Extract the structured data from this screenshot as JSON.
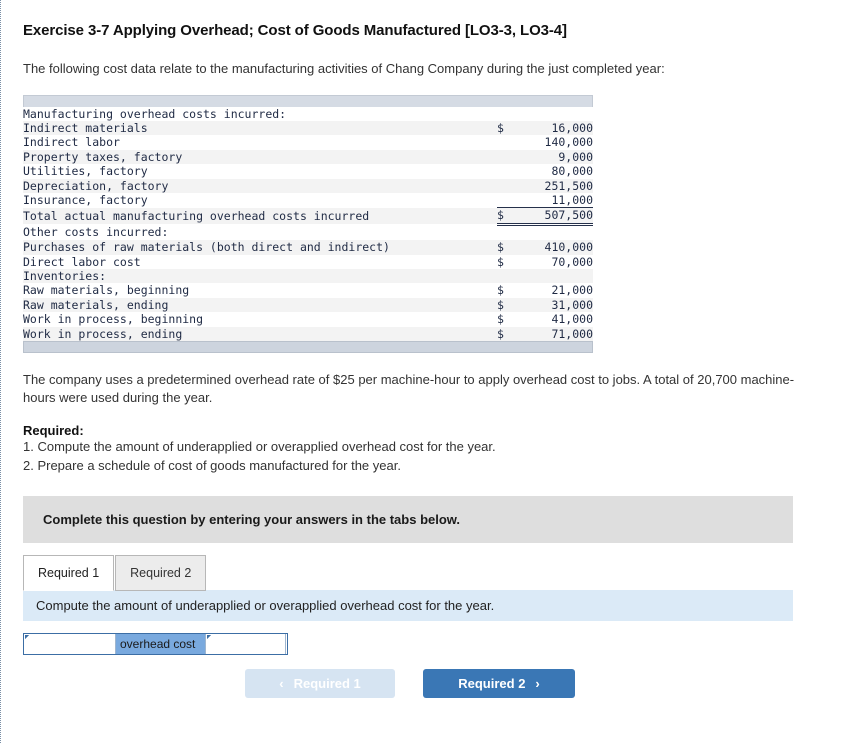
{
  "exercise": {
    "title": "Exercise 3-7 Applying Overhead; Cost of Goods Manufactured [LO3-3, LO3-4]",
    "intro": "The following cost data relate to the manufacturing activities of Chang Company during the just completed year:",
    "mid_paragraph": "The company uses a predetermined overhead rate of $25 per machine-hour to apply overhead cost to jobs. A total of 20,700 machine-hours were used during the year.",
    "required_heading": "Required:",
    "required_items": [
      "1. Compute the amount of underapplied or overapplied overhead cost for the year.",
      "2. Prepare a schedule of cost of goods manufactured for the year."
    ]
  },
  "cost_table": {
    "rows": [
      {
        "label": "Manufacturing overhead costs incurred:",
        "indent": 0,
        "currency": "",
        "amount": "",
        "total": false
      },
      {
        "label": "Indirect materials",
        "indent": 1,
        "currency": "$",
        "amount": "16,000",
        "total": false
      },
      {
        "label": "Indirect labor",
        "indent": 1,
        "currency": "",
        "amount": "140,000",
        "total": false
      },
      {
        "label": "Property taxes, factory",
        "indent": 1,
        "currency": "",
        "amount": "9,000",
        "total": false
      },
      {
        "label": "Utilities, factory",
        "indent": 1,
        "currency": "",
        "amount": "80,000",
        "total": false
      },
      {
        "label": "Depreciation, factory",
        "indent": 1,
        "currency": "",
        "amount": "251,500",
        "total": false
      },
      {
        "label": "Insurance, factory",
        "indent": 1,
        "currency": "",
        "amount": "11,000",
        "total": false
      },
      {
        "label": "Total actual manufacturing overhead costs incurred",
        "indent": 1,
        "currency": "$",
        "amount": "507,500",
        "total": true
      },
      {
        "label": "Other costs incurred:",
        "indent": 0,
        "currency": "",
        "amount": "",
        "total": false
      },
      {
        "label": "Purchases of raw materials (both direct and indirect)",
        "indent": 1,
        "currency": "$",
        "amount": "410,000",
        "total": false
      },
      {
        "label": "Direct labor cost",
        "indent": 1,
        "currency": "$",
        "amount": "70,000",
        "total": false
      },
      {
        "label": "Inventories:",
        "indent": 0,
        "currency": "",
        "amount": "",
        "total": false
      },
      {
        "label": "Raw materials, beginning",
        "indent": 1,
        "currency": "$",
        "amount": "21,000",
        "total": false
      },
      {
        "label": "Raw materials, ending",
        "indent": 1,
        "currency": "$",
        "amount": "31,000",
        "total": false
      },
      {
        "label": "Work in process, beginning",
        "indent": 1,
        "currency": "$",
        "amount": "41,000",
        "total": false
      },
      {
        "label": "Work in process, ending",
        "indent": 1,
        "currency": "$",
        "amount": "71,000",
        "total": false
      }
    ]
  },
  "answer_area": {
    "banner": "Complete this question by entering your answers in the tabs below.",
    "tabs": [
      {
        "label": "Required 1",
        "active": true
      },
      {
        "label": "Required 2",
        "active": false
      }
    ],
    "question": "Compute the amount of underapplied or overapplied overhead cost for the year.",
    "input_left_value": "",
    "input_left_placeholder": "",
    "middle_label": "overhead cost",
    "input_right_value": "",
    "input_right_placeholder": "",
    "nav": {
      "prev_label": "Required 1",
      "prev_chevron": "‹",
      "next_label": "Required 2",
      "next_chevron": "›"
    }
  },
  "colors": {
    "accent_blue": "#3a77b5",
    "disabled_blue": "#d6e4f2",
    "band_gray": "#dedede",
    "band_blue": "#dbeaf7",
    "table_bar": "#d5dbe4",
    "cell_label_blue": "#79a9de"
  }
}
